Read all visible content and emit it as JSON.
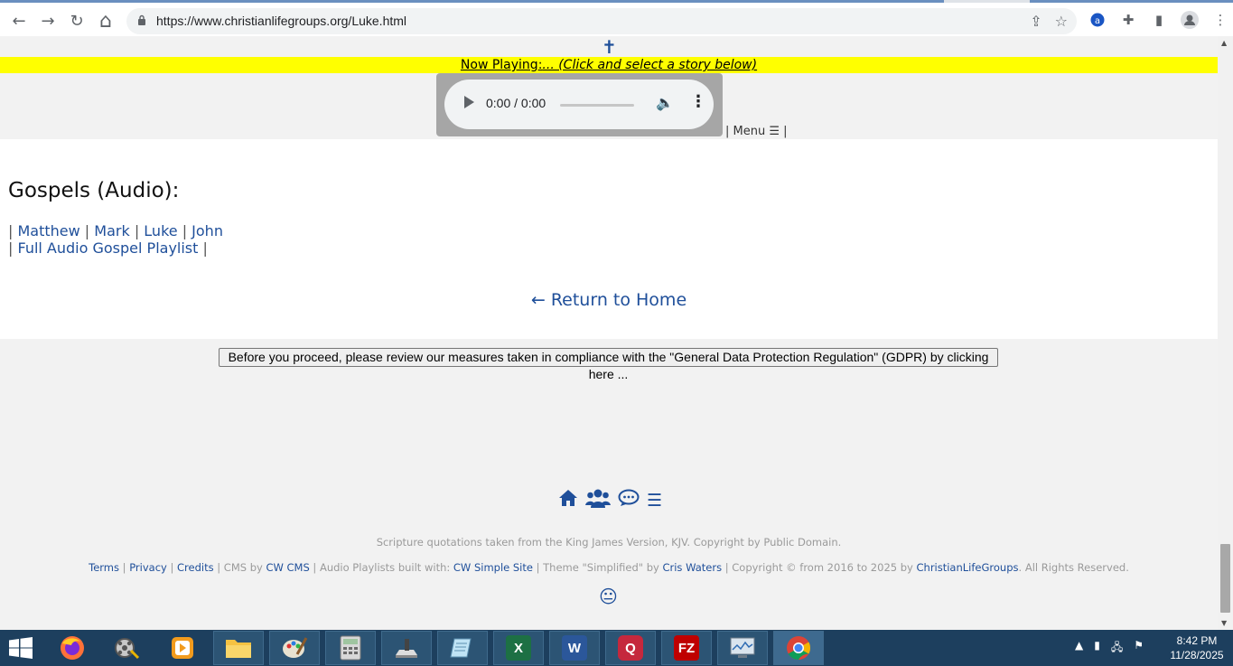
{
  "browser": {
    "url": "https://www.christianlifegroups.org/Luke.html",
    "nav": {
      "back": "←",
      "forward": "→",
      "reload": "↻",
      "home": "⌂"
    },
    "omni_icons": [
      "share-icon",
      "star-icon"
    ],
    "extensions": [
      "extension-a-icon",
      "puzzle-icon",
      "side-panel-icon",
      "profile-icon",
      "kebab-menu-icon"
    ]
  },
  "page": {
    "cross": "✝",
    "now_playing_label": "Now Playing:",
    "now_playing_value": "... (Click and select a story below)",
    "player": {
      "time": "0:00 / 0:00"
    },
    "menu": {
      "prefix": "| ",
      "label": "Menu ☰",
      "suffix": " |"
    },
    "section_title": "Gospels (Audio):",
    "gospel_links": [
      "Matthew",
      "Mark",
      "Luke",
      "John"
    ],
    "playlist_link": "Full Audio Gospel Playlist",
    "return_home": "← Return to Home",
    "gdpr_button": "Before you proceed, please review our measures taken in compliance with the \"General Data Protection Regulation\" (GDPR) by clicking here ...",
    "footer": {
      "scripture": "Scripture quotations taken from the King James Version, KJV. Copyright by Public Domain.",
      "terms": "Terms",
      "privacy": "Privacy",
      "credits": "Credits",
      "cms_by": "CMS by",
      "cw_cms": "CW CMS",
      "playlists_built": "Audio Playlists built with:",
      "cw_simple_site": "CW Simple Site",
      "theme": "Theme \"Simplified\" by",
      "cris_waters": "Cris Waters",
      "copyright": "Copyright © from 2016 to 2025 by",
      "clg": "ChristianLifeGroups",
      "rights": "All Rights Reserved.",
      "smiley": "😐"
    }
  },
  "taskbar": {
    "time": "8:42 PM",
    "date": "11/28/2025"
  }
}
